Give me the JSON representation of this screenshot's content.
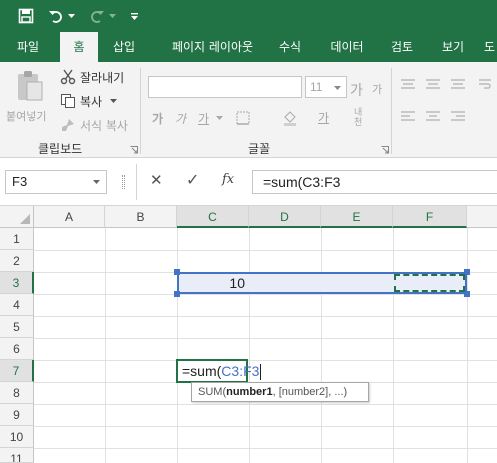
{
  "qat": {
    "icons": [
      "save-icon",
      "undo-icon",
      "redo-icon",
      "customize-icon"
    ]
  },
  "tabs": [
    {
      "label": "파일"
    },
    {
      "label": "홈"
    },
    {
      "label": "삽입"
    },
    {
      "label": "페이지 레이아웃"
    },
    {
      "label": "수식"
    },
    {
      "label": "데이터"
    },
    {
      "label": "검토"
    },
    {
      "label": "보기"
    }
  ],
  "ribbon": {
    "paste_label": "붙여넣기",
    "cut_label": "잘라내기",
    "copy_label": "복사",
    "format_painter_label": "서식 복사",
    "clipboard_group": "클립보드",
    "font_group": "글꼴",
    "font_size": "11",
    "grow_font": "가",
    "shrink_font": "가",
    "bold": "가",
    "italic": "가",
    "underline": "가",
    "font_color": "가",
    "phonetic": "내천"
  },
  "formula_bar": {
    "name_box": "F3",
    "cancel": "✕",
    "enter": "✓",
    "fx": "fx",
    "formula": "=sum(C3:F3"
  },
  "grid": {
    "columns": [
      "A",
      "B",
      "C",
      "D",
      "E",
      "F"
    ],
    "rows": [
      "1",
      "2",
      "3",
      "4",
      "5",
      "6",
      "7",
      "8",
      "9",
      "10",
      "11"
    ],
    "c3_value": "10",
    "c7_prefix": "=sum(",
    "c7_ref": "C3:F3",
    "tooltip_func": "SUM(",
    "tooltip_arg1": "number1",
    "tooltip_rest": ", [number2], ...)"
  },
  "colors": {
    "excel_green": "#217346",
    "ref_blue": "#4472c4",
    "tint": "#e8edf8"
  }
}
